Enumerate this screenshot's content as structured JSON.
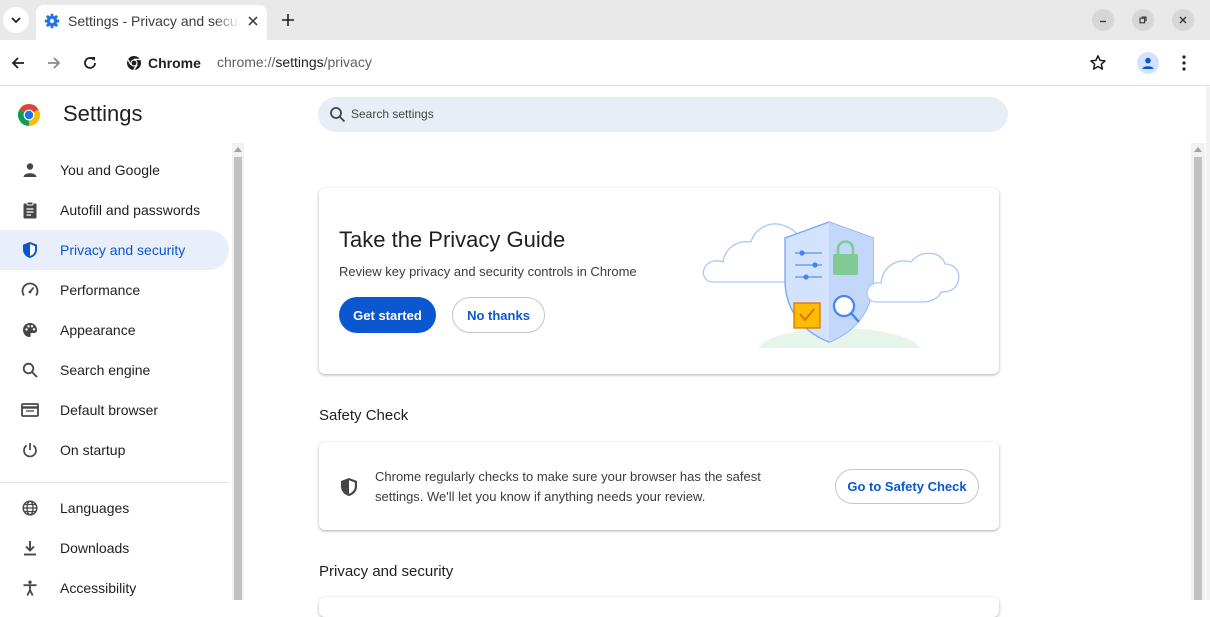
{
  "browser": {
    "tab_title": "Settings - Privacy and security",
    "omnibox_chip": "Chrome",
    "url_scheme": "chrome://",
    "url_host": "settings",
    "url_path": "/privacy"
  },
  "header": {
    "title": "Settings",
    "search_placeholder": "Search settings"
  },
  "sidebar": {
    "items": [
      {
        "label": "You and Google",
        "icon": "person-icon"
      },
      {
        "label": "Autofill and passwords",
        "icon": "clipboard-icon"
      },
      {
        "label": "Privacy and security",
        "icon": "shield-icon",
        "active": true
      },
      {
        "label": "Performance",
        "icon": "speedometer-icon"
      },
      {
        "label": "Appearance",
        "icon": "palette-icon"
      },
      {
        "label": "Search engine",
        "icon": "search-icon"
      },
      {
        "label": "Default browser",
        "icon": "browser-window-icon"
      },
      {
        "label": "On startup",
        "icon": "power-icon"
      },
      {
        "label": "Languages",
        "icon": "globe-icon"
      },
      {
        "label": "Downloads",
        "icon": "download-icon"
      },
      {
        "label": "Accessibility",
        "icon": "accessibility-icon"
      }
    ]
  },
  "privacy_guide": {
    "title": "Take the Privacy Guide",
    "description": "Review key privacy and security controls in Chrome",
    "primary_button": "Get started",
    "secondary_button": "No thanks"
  },
  "safety_check": {
    "section_title": "Safety Check",
    "description": "Chrome regularly checks to make sure your browser has the safest settings. We'll let you know if anything needs your review.",
    "button": "Go to Safety Check"
  },
  "privacy_section": {
    "title": "Privacy and security"
  },
  "colors": {
    "accent": "#0b57d0",
    "active_nav_bg": "#e8eefa",
    "search_bg": "#e9eef6",
    "tabstrip_bg": "#e9e9e9"
  }
}
